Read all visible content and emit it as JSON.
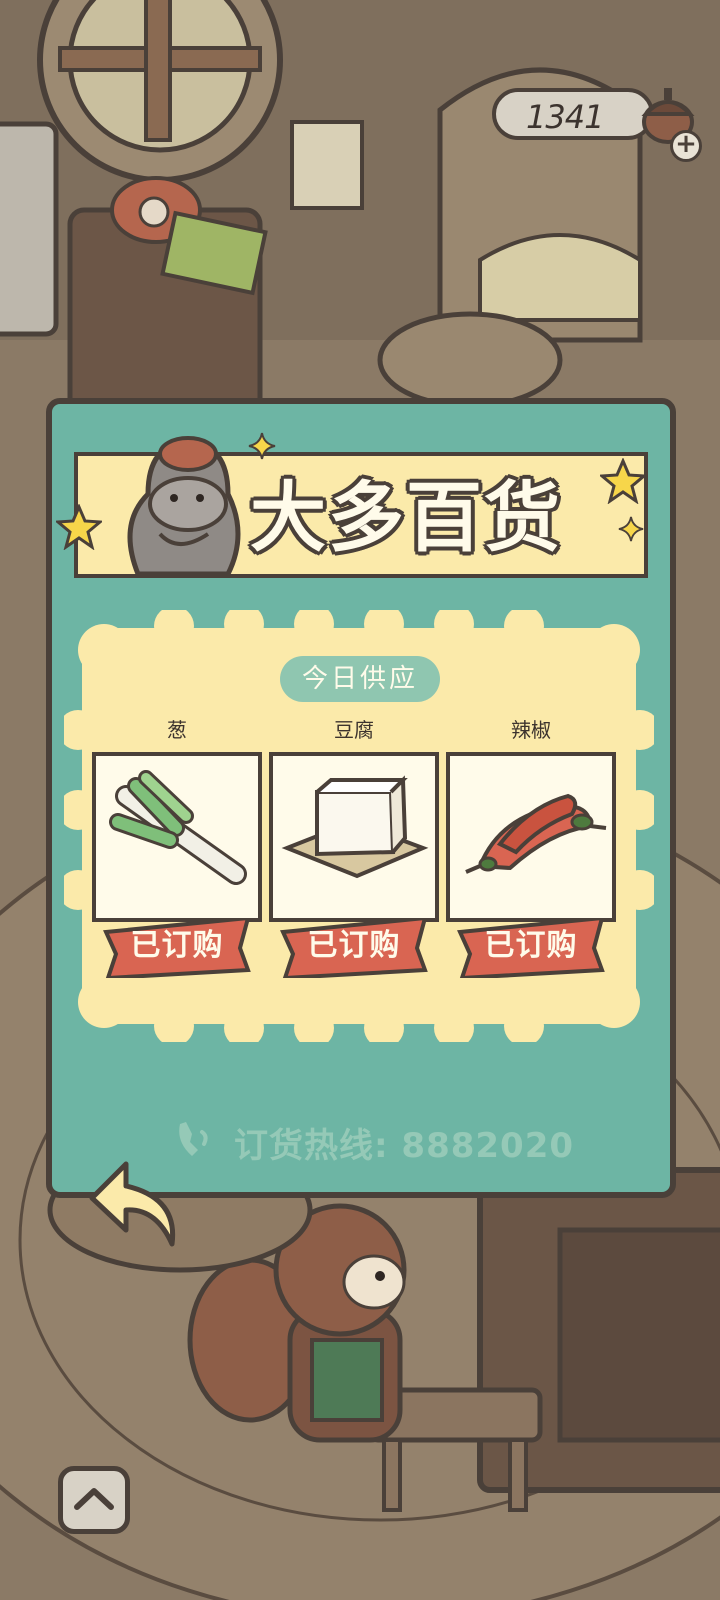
{
  "status": {
    "coins": "1341"
  },
  "shop": {
    "title": "大多百货",
    "section_label": "今日供应",
    "items": [
      {
        "name": "葱",
        "status": "已订购",
        "icon": "green-onion-icon"
      },
      {
        "name": "豆腐",
        "status": "已订购",
        "icon": "tofu-icon"
      },
      {
        "name": "辣椒",
        "status": "已订购",
        "icon": "chili-pepper-icon"
      }
    ],
    "hotline": "订货热线: 8882020"
  },
  "colors": {
    "panel": "#6db5a4",
    "banner": "#fbeaaa",
    "outline": "#4a4039",
    "ordered_badge": "#d96552",
    "card_bg": "#fbeaaa"
  }
}
